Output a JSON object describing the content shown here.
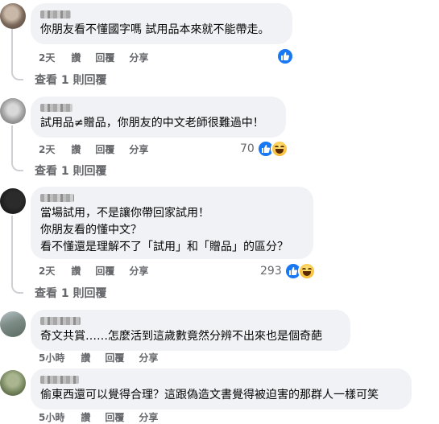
{
  "comments": [
    {
      "text_lines": [
        "你朋友看不懂國字嗎 試用品本來就不能帶走。"
      ],
      "time": "2天",
      "like": "讚",
      "reply": "回覆",
      "share": "分享",
      "reaction_count": "",
      "view_replies": "查看 1 則回覆"
    },
    {
      "text_lines": [
        "試用品≠贈品，你朋友的中文老師很難過中！"
      ],
      "time": "2天",
      "like": "讚",
      "reply": "回覆",
      "share": "分享",
      "reaction_count": "70",
      "view_replies": "查看 1 則回覆"
    },
    {
      "text_lines": [
        "當場試用，不是讓你帶回家試用！",
        "你朋友看的懂中文？",
        "看不懂還是理解不了「試用」和「贈品」的區分？"
      ],
      "time": "2天",
      "like": "讚",
      "reply": "回覆",
      "share": "分享",
      "reaction_count": "293",
      "view_replies": "查看 1 則回覆"
    },
    {
      "text_lines": [
        "奇文共賞……怎麼活到這歲數竟然分辨不出來也是個奇葩"
      ],
      "time": "5小時",
      "like": "讚",
      "reply": "回覆",
      "share": "分享"
    },
    {
      "text_lines": [
        "偷東西還可以覺得合理？這跟偽造文書覺得被迫害的那群人一樣可笑"
      ],
      "time": "5小時",
      "like": "讚",
      "reply": "回覆",
      "share": "分享"
    }
  ],
  "colors": {
    "bubble": "#f0f2f5",
    "meta": "#65676b",
    "like": "#1877f2"
  },
  "icons": [
    "like-icon",
    "haha-icon"
  ]
}
